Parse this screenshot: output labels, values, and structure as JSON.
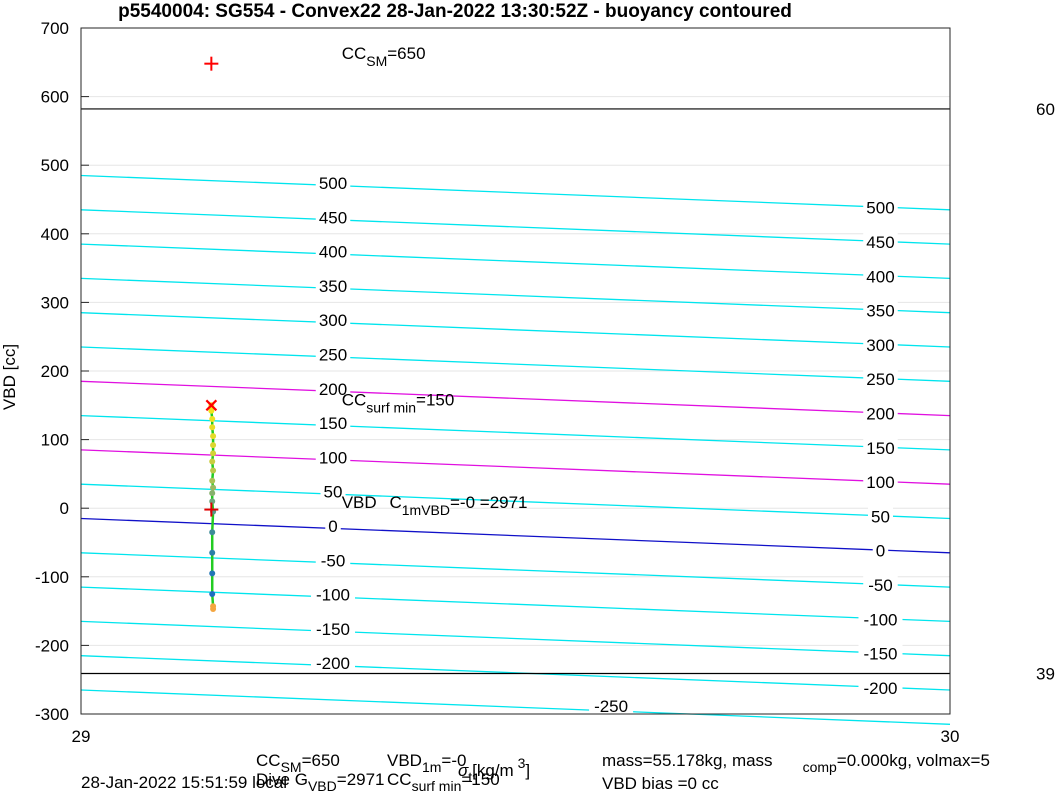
{
  "chart_data": {
    "type": "line",
    "title": "p5540004: SG554 - Convex22 28-Jan-2022 13:30:52Z - buoyancy contoured",
    "ylabel": "VBD [cc]",
    "xlabel": "σ t [kg/m 3]",
    "xlim": [
      29,
      30
    ],
    "ylim": [
      -300,
      700
    ],
    "x_ticks": [
      "29",
      "30"
    ],
    "y_ticks": [
      "-300",
      "-200",
      "-100",
      "0",
      "100",
      "200",
      "300",
      "400",
      "500",
      "600",
      "700"
    ],
    "grid": true,
    "reference_lines": [
      {
        "name": "upper limit",
        "value": 582,
        "right_label": "60"
      },
      {
        "name": "lower limit",
        "value": -241,
        "right_label": "39"
      }
    ],
    "contours": {
      "x_start": 29.0,
      "x_end": 30.0,
      "drop": 50,
      "levels": [
        -250,
        -200,
        -150,
        -100,
        -50,
        0,
        50,
        100,
        150,
        200,
        250,
        300,
        350,
        400,
        450,
        500
      ],
      "highlighted": [
        {
          "level": 0,
          "color": "#1010c8"
        },
        {
          "level": 100,
          "color": "#e010e0"
        },
        {
          "level": 200,
          "color": "#e010e0"
        }
      ],
      "left_labels": [
        {
          "text": "500",
          "x": 29.29,
          "y": 474
        },
        {
          "text": "450",
          "x": 29.29,
          "y": 424
        },
        {
          "text": "400",
          "x": 29.29,
          "y": 374
        },
        {
          "text": "350",
          "x": 29.29,
          "y": 324
        },
        {
          "text": "300",
          "x": 29.29,
          "y": 274
        },
        {
          "text": "250",
          "x": 29.29,
          "y": 224
        },
        {
          "text": "200",
          "x": 29.29,
          "y": 174
        },
        {
          "text": "150",
          "x": 29.29,
          "y": 124
        },
        {
          "text": "100",
          "x": 29.29,
          "y": 74
        },
        {
          "text": "50",
          "x": 29.29,
          "y": 24
        },
        {
          "text": "0",
          "x": 29.29,
          "y": -26
        },
        {
          "text": "-50",
          "x": 29.29,
          "y": -76
        },
        {
          "text": "-100",
          "x": 29.29,
          "y": -126
        },
        {
          "text": "-150",
          "x": 29.29,
          "y": -176
        },
        {
          "text": "-200",
          "x": 29.29,
          "y": -226
        },
        {
          "text": "-250",
          "x": 29.61,
          "y": -288
        }
      ],
      "right_labels": [
        {
          "text": "500",
          "x": 29.92,
          "y": 438
        },
        {
          "text": "450",
          "x": 29.92,
          "y": 388
        },
        {
          "text": "400",
          "x": 29.92,
          "y": 338
        },
        {
          "text": "350",
          "x": 29.92,
          "y": 288
        },
        {
          "text": "300",
          "x": 29.92,
          "y": 238
        },
        {
          "text": "250",
          "x": 29.92,
          "y": 188
        },
        {
          "text": "200",
          "x": 29.92,
          "y": 138
        },
        {
          "text": "150",
          "x": 29.92,
          "y": 88
        },
        {
          "text": "100",
          "x": 29.92,
          "y": 38
        },
        {
          "text": "50",
          "x": 29.92,
          "y": -12
        },
        {
          "text": "0",
          "x": 29.92,
          "y": -62
        },
        {
          "text": "-50",
          "x": 29.92,
          "y": -112
        },
        {
          "text": "-100",
          "x": 29.92,
          "y": -162
        },
        {
          "text": "-150",
          "x": 29.92,
          "y": -212
        },
        {
          "text": "-200",
          "x": 29.92,
          "y": -262
        }
      ]
    },
    "profile": {
      "x": [
        29.15,
        29.15,
        29.151,
        29.151,
        29.152,
        29.152,
        29.152,
        29.151,
        29.152,
        29.151,
        29.152,
        29.151,
        29.151,
        29.152,
        29.151,
        29.151,
        29.151,
        29.151,
        29.152,
        29.152
      ],
      "y": [
        150,
        142,
        130,
        118,
        105,
        92,
        80,
        68,
        55,
        40,
        30,
        22,
        10,
        -5,
        -35,
        -65,
        -95,
        -125,
        -143,
        -147
      ],
      "colors": [
        "#f5e616",
        "#f2e31a",
        "#eee020",
        "#e9dd25",
        "#e4da2a",
        "#ddd630",
        "#d4d238",
        "#c9cd40",
        "#bcc84a",
        "#abc156",
        "#9aba62",
        "#86b16e",
        "#6da67c",
        "#55998a",
        "#3d8c98",
        "#2a80a8",
        "#2176b6",
        "#1d6dc0",
        "#f4a640",
        "#f4a640"
      ]
    },
    "markers": [
      {
        "name": "CC_SM",
        "x": 29.15,
        "y": 648,
        "symbol": "+",
        "color": "#ff0000"
      },
      {
        "name": "surface",
        "x": 29.15,
        "y": 150,
        "symbol": "x",
        "color": "#ff0000"
      },
      {
        "name": "VBD",
        "x": 29.15,
        "y": -2,
        "symbol": "+",
        "color": "#e00000"
      }
    ],
    "annotations": [
      {
        "name": "cc-sm",
        "main": "CC",
        "sub": "SM",
        "rest": "=650",
        "x": 29.3,
        "y": 655
      },
      {
        "name": "cc-surf-min",
        "main": "CC",
        "sub": "surf min",
        "rest": "=150",
        "x": 29.3,
        "y": 150
      },
      {
        "name": "vbd-over",
        "main": "VBD",
        "sub": "",
        "rest": "",
        "x": 29.3,
        "y": 0
      },
      {
        "name": "c-1m-vbd",
        "main": "C",
        "sub": "1mVBD",
        "rest": "=-0 =2971",
        "x": 29.355,
        "y": 0
      }
    ]
  },
  "footer": {
    "timestamp": "28-Jan-2022 15:51:59 local",
    "dive": "Dive G",
    "dive_sub": "VBD",
    "dive_rest": "=2971",
    "cc_sm": "CC",
    "cc_sm_sub": "SM",
    "cc_sm_rest": "=650",
    "vbd": "VBD",
    "vbd_sub": "1m",
    "vbd_rest": "=-0",
    "cc_surf": "CC",
    "cc_surf_sub": "surf min",
    "cc_surf_rest": "=150",
    "mass": "mass=55.178kg, mass",
    "mass_sub": "comp",
    "mass_rest": "=0.000kg, volmax=5",
    "bias": "VBD bias =0 cc"
  },
  "colors": {
    "contour": "#00e5ee",
    "grid": "#e6e6e6",
    "profile_line": "#22cc22",
    "reference": "#000000"
  }
}
